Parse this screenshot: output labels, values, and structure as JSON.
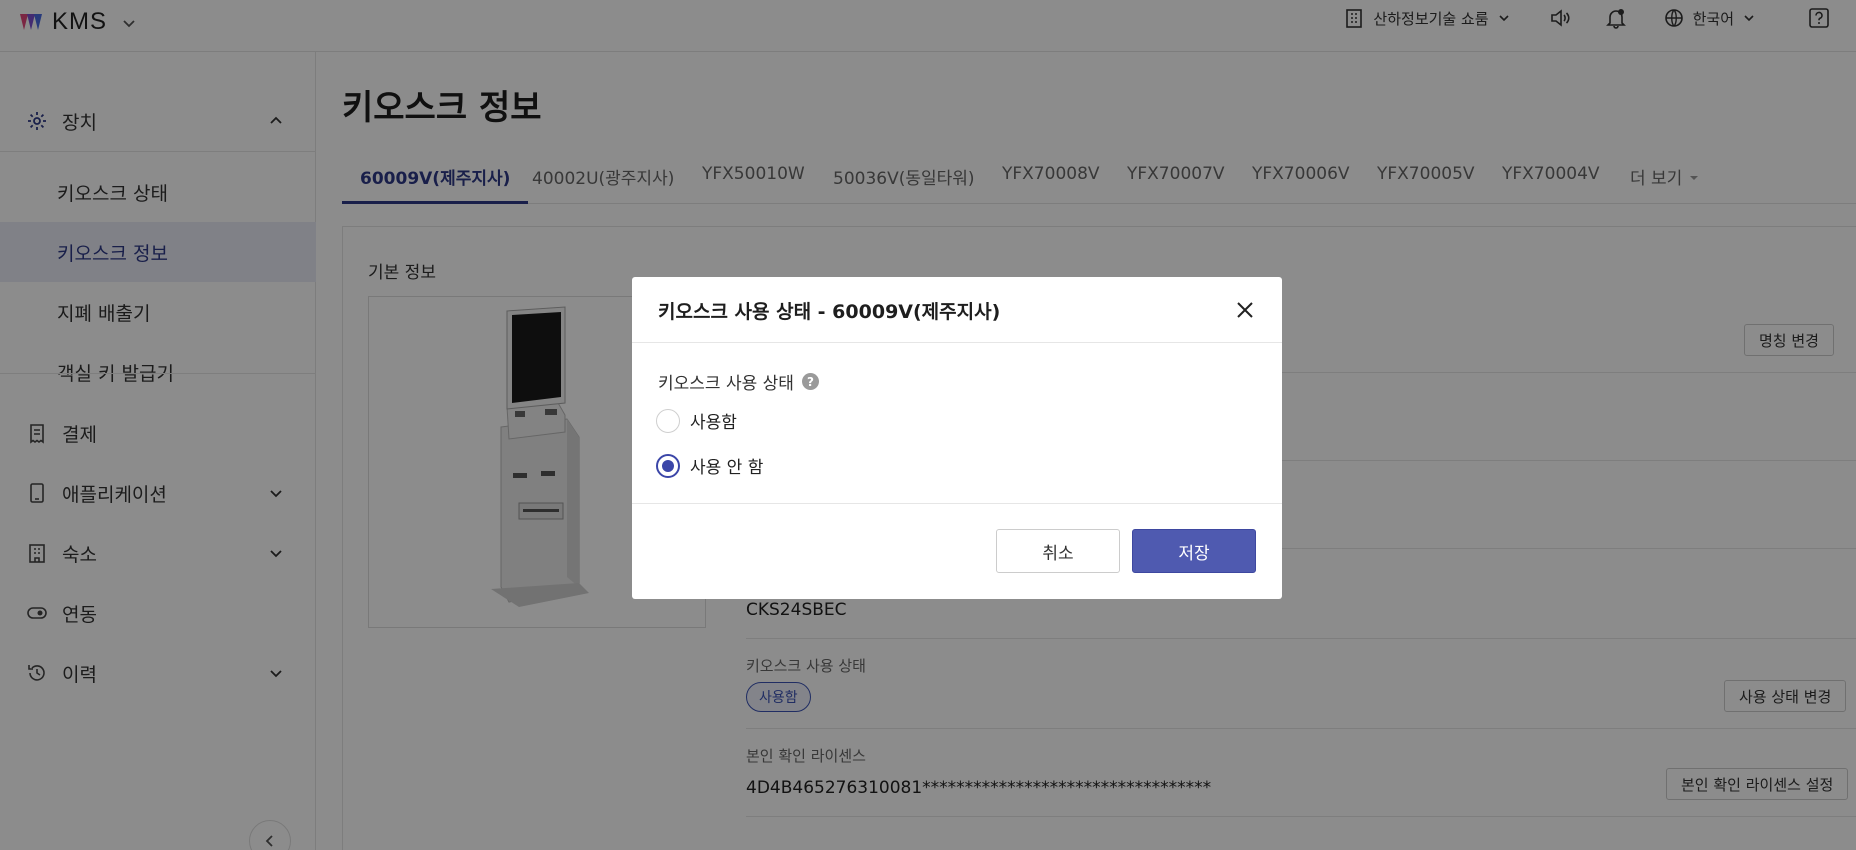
{
  "header": {
    "app_name": "KMS",
    "store_name": "산하정보기술 쇼룸",
    "language": "한국어",
    "icons": [
      "building-icon",
      "speaker-icon",
      "bell-icon",
      "globe-icon",
      "help-icon"
    ]
  },
  "sidebar": {
    "groups": [
      {
        "label": "장치",
        "icon": "gear-icon",
        "expanded": true
      },
      {
        "label": "결제",
        "icon": "receipt-icon"
      },
      {
        "label": "애플리케이션",
        "icon": "tablet-icon"
      },
      {
        "label": "숙소",
        "icon": "building-icon"
      },
      {
        "label": "연동",
        "icon": "toggle-icon"
      },
      {
        "label": "이력",
        "icon": "history-icon"
      }
    ],
    "device_items": [
      "키오스크 상태",
      "키오스크 정보",
      "지폐 배출기",
      "객실 키 발급기"
    ],
    "active_item": "키오스크 정보"
  },
  "page": {
    "title": "키오스크 정보",
    "tabs": [
      "60009V(제주지사)",
      "40002U(광주지사)",
      "YFX50010W",
      "50036V(동일타워)",
      "YFX70008V",
      "YFX70007V",
      "YFX70006V",
      "YFX70005V",
      "YFX70004V"
    ],
    "active_tab": "60009V(제주지사)",
    "more_label": "더 보기"
  },
  "basic_info": {
    "title": "기본 정보",
    "rename_button": "명칭 변경",
    "model_value": "CKS24SBEC",
    "usage_label": "키오스크 사용 상태",
    "usage_value": "사용함",
    "usage_button": "사용 상태 변경",
    "license_label": "본인 확인 라이센스",
    "license_value": "4D4B465276310081**********************************",
    "license_button": "본인 확인 라이센스 설정"
  },
  "modal": {
    "title": "키오스크 사용 상태 - 60009V(제주지사)",
    "field_label": "키오스크 사용 상태",
    "help_glyph": "?",
    "options": [
      {
        "label": "사용함",
        "selected": false
      },
      {
        "label": "사용 안 함",
        "selected": true
      }
    ],
    "cancel_label": "취소",
    "save_label": "저장"
  },
  "colors": {
    "accent": "#2e3a87",
    "primary_button": "#4f5ab0",
    "overlay": "rgba(0,0,0,0.45)"
  }
}
